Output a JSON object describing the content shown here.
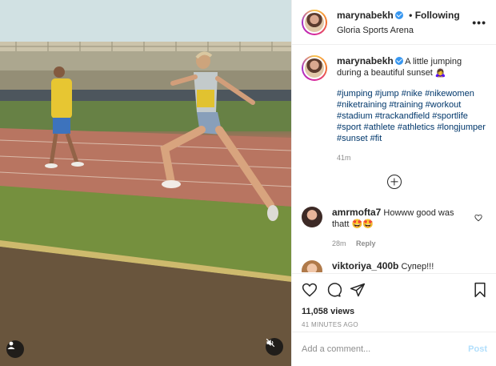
{
  "post": {
    "username": "marynabekh",
    "follow_label": "• Following",
    "location": "Gloria Sports Arena",
    "more_icon": "more-horizontal-icon"
  },
  "caption": {
    "username": "marynabekh",
    "text": "A little jumping during a beautiful sunset 🙇‍♀️",
    "hashtags": "#jumping #jump #nike #nikewomen #niketraining #training #workout #stadium #trackandfield #sportlife #sport #athlete #athletics #longjumper #sunset #fit",
    "time": "41m"
  },
  "load_more_icon": "plus-circle-icon",
  "comments": [
    {
      "username": "amrmofta7",
      "text": "Howww good was thatt 🤩🤩",
      "time": "28m",
      "reply_label": "Reply"
    },
    {
      "username": "viktoriya_400b",
      "text": "Супер!!!"
    }
  ],
  "actions": {
    "likes": "11,058 views",
    "ago": "41 MINUTES AGO"
  },
  "composer": {
    "placeholder": "Add a comment...",
    "post_label": "Post"
  },
  "colors": {
    "link": "#00376b",
    "verified": "#3897f0",
    "post_disabled": "#b2dffc",
    "muted": "#8e8e8e"
  }
}
